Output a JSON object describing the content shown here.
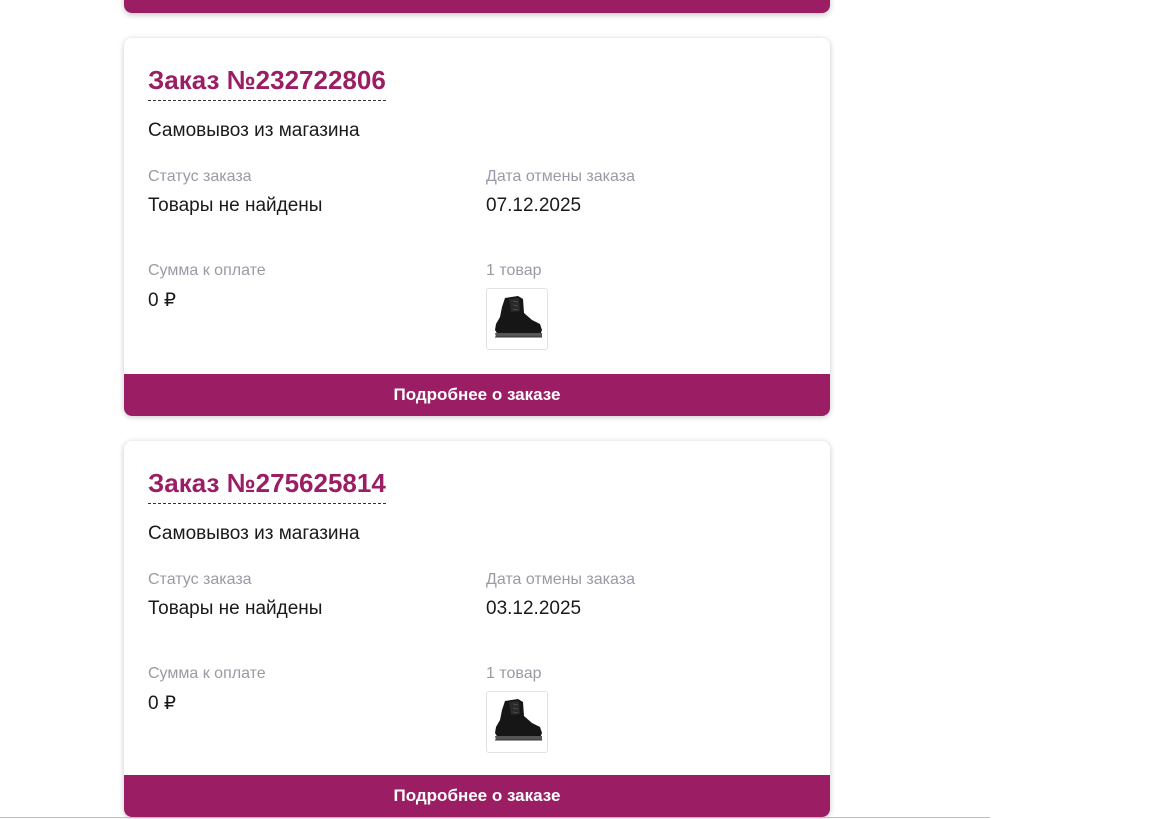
{
  "colors": {
    "accent": "#9b1e64",
    "label": "#9a9aa6",
    "text": "#1a1a1a"
  },
  "orders": [
    {
      "title": "Заказ №232722806",
      "delivery": "Самовывоз из магазина",
      "status_label": "Статус заказа",
      "status_value": "Товары не найдены",
      "cancel_date_label": "Дата отмены заказа",
      "cancel_date_value": "07.12.2025",
      "sum_label": "Сумма к оплате",
      "sum_value": "0 ₽",
      "items_count": "1 товар",
      "item_icon": "black-boot-image",
      "details_button": "Подробнее о заказе"
    },
    {
      "title": "Заказ №275625814",
      "delivery": "Самовывоз из магазина",
      "status_label": "Статус заказа",
      "status_value": "Товары не найдены",
      "cancel_date_label": "Дата отмены заказа",
      "cancel_date_value": "03.12.2025",
      "sum_label": "Сумма к оплате",
      "sum_value": "0 ₽",
      "items_count": "1 товар",
      "item_icon": "black-boot-image",
      "details_button": "Подробнее о заказе"
    }
  ]
}
